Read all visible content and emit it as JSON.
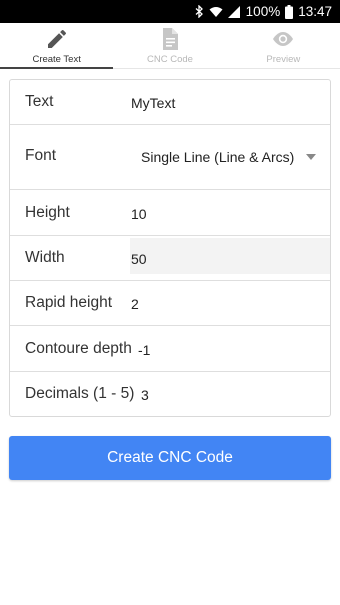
{
  "status_bar": {
    "battery": "100%",
    "time": "13:47"
  },
  "tabs": [
    {
      "label": "Create Text",
      "icon": "pencil-icon",
      "active": true
    },
    {
      "label": "CNC Code",
      "icon": "document-icon",
      "active": false
    },
    {
      "label": "Preview",
      "icon": "eye-icon",
      "active": false
    }
  ],
  "form": {
    "text": {
      "label": "Text",
      "value": "MyText"
    },
    "font": {
      "label": "Font",
      "value": "Single Line (Line & Arcs)"
    },
    "height": {
      "label": "Height",
      "value": "10"
    },
    "width": {
      "label": "Width",
      "value": "50"
    },
    "rapid_height": {
      "label": "Rapid height",
      "value": "2"
    },
    "contour_depth": {
      "label": "Contoure depth",
      "value": "-1"
    },
    "decimals": {
      "label": "Decimals (1 - 5)",
      "value": "3"
    }
  },
  "create_button": {
    "label": "Create CNC Code"
  },
  "colors": {
    "accent": "#4285f4",
    "status_bar": "#000000",
    "active_tab": "#444444",
    "inactive_tab": "#b8b8b8"
  }
}
